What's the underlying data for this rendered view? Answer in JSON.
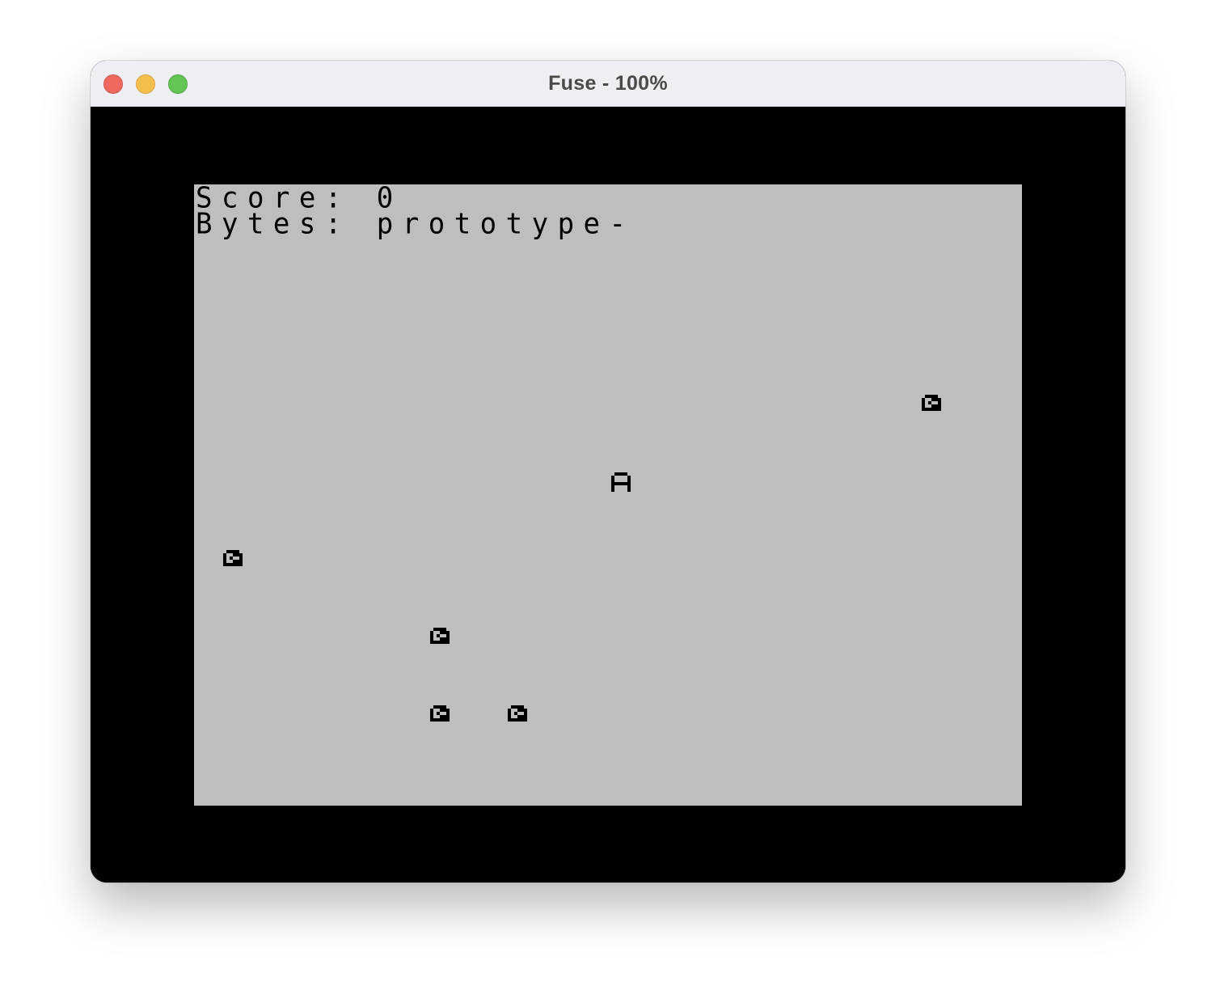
{
  "window": {
    "title": "Fuse - 100%",
    "controls": [
      "close",
      "minimize",
      "zoom"
    ]
  },
  "screen": {
    "border_color": "#000000",
    "paper_color": "#bebebe",
    "ink_color": "#000000",
    "hud": {
      "score_line": "Score: 0",
      "bytes_line": "Bytes: prototype-"
    },
    "player": {
      "glyph": "A"
    },
    "enemies": {
      "icon": "disc-enemy-icon",
      "count": 5
    }
  }
}
